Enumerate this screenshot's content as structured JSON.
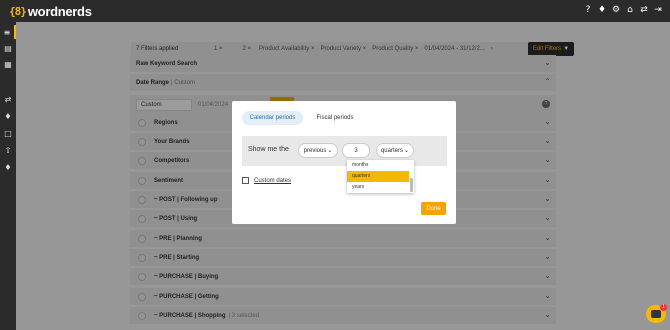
{
  "app": {
    "logo_mark": "{8}",
    "name": "wordnerds"
  },
  "topbar_icons": [
    "help-icon",
    "bell-icon",
    "gear-icon",
    "home-icon",
    "share-icon",
    "logout-icon"
  ],
  "sidebar_icons": [
    "filter-icon",
    "document-icon",
    "grid-icon",
    "sliders-icon",
    "bell-icon",
    "chat-icon",
    "upload-icon",
    "bell-icon"
  ],
  "filterbar": {
    "applied": "7 Filters applied",
    "chips": [
      "1 ×",
      "2 ×",
      "Product Availability ×",
      "Product Variety ×",
      "Product Quality ×",
      "01/04/2024 - 31/12/2...",
      "›"
    ],
    "edit_label": "Edit Filters"
  },
  "sections": {
    "keyword": "Raw Keyword Search",
    "date_range": "Date Range",
    "date_range_sub": "| Custom"
  },
  "date_row": {
    "select_value": "Custom",
    "start": "01/04/2024",
    "info": "?"
  },
  "rows": [
    {
      "label": "Regions",
      "sub": ""
    },
    {
      "label": "Your Brands",
      "sub": ""
    },
    {
      "label": "Competitors",
      "sub": ""
    },
    {
      "label": "Sentiment",
      "sub": ""
    },
    {
      "label": "~ POST | Following up",
      "sub": ""
    },
    {
      "label": "~ POST | Using",
      "sub": ""
    },
    {
      "label": "~ PRE | Planning",
      "sub": ""
    },
    {
      "label": "~ PRE | Starting",
      "sub": ""
    },
    {
      "label": "~ PURCHASE | Buying",
      "sub": ""
    },
    {
      "label": "~ PURCHASE | Getting",
      "sub": ""
    },
    {
      "label": "~ PURCHASE | Shopping",
      "sub": "| 3 selected"
    }
  ],
  "modal": {
    "tab_calendar": "Calendar periods",
    "tab_fiscal": "Fiscal periods",
    "show_label": "Show me the",
    "direction": "previous",
    "count": "3",
    "unit": "quarters",
    "unit_options": [
      "months",
      "quarters",
      "years"
    ],
    "selected_option": "quarters",
    "custom_dates": "Custom dates",
    "done": "Done"
  },
  "chat": {
    "badge": "1"
  }
}
